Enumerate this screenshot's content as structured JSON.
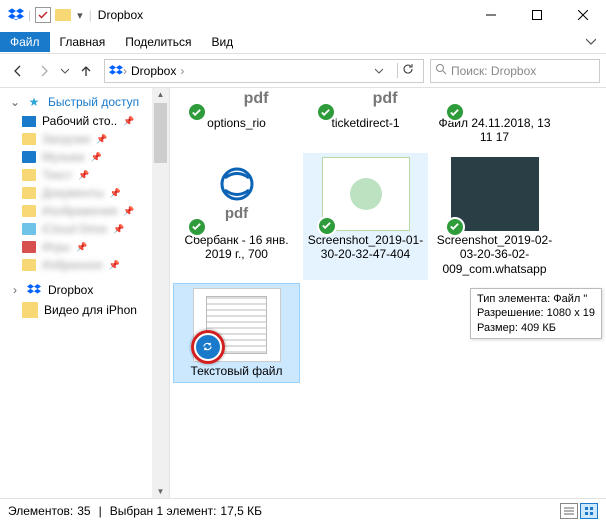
{
  "titlebar": {
    "title": "Dropbox"
  },
  "menubar": {
    "file": "Файл",
    "home": "Главная",
    "share": "Поделиться",
    "view": "Вид"
  },
  "nav": {
    "crumb": "Dropbox",
    "search_placeholder": "Поиск: Dropbox"
  },
  "sidebar": {
    "quick_access": "Быстрый доступ",
    "desktop": "Рабочий сто..",
    "blurred": [
      "Загрузки",
      "Музыка",
      "Текст",
      "Документы",
      "Изображения",
      "iCloud Drive",
      "Игры",
      "Избранное"
    ],
    "dropbox": "Dropbox",
    "videos": "Видео для iPhon"
  },
  "files": [
    {
      "name": "options_rio",
      "type": "pdf-stub"
    },
    {
      "name": "ticketdirect-1",
      "type": "pdf-stub"
    },
    {
      "name": "Файл 24.11.2018, 13 11 17",
      "type": "icon-stub"
    },
    {
      "name": "Сбербанк - 16 янв. 2019 г., 700",
      "type": "edge-pdf"
    },
    {
      "name": "Screenshot_2019-01-30-20-32-47-404",
      "type": "screenshot",
      "selectedBg": true
    },
    {
      "name": "Screenshot_2019-02-03-20-36-02-009_com.whatsapp",
      "type": "whatsapp"
    },
    {
      "name": "Текстовый файл",
      "type": "doc",
      "selected": true,
      "syncHighlight": true
    }
  ],
  "tooltip": {
    "l1": "Тип элемента: Файл \"",
    "l2": "Разрешение: 1080 x 19",
    "l3": "Размер: 409 КБ"
  },
  "statusbar": {
    "count_label": "Элементов:",
    "count": "35",
    "selected_label": "Выбран 1 элемент:",
    "selected_size": "17,5 КБ"
  }
}
